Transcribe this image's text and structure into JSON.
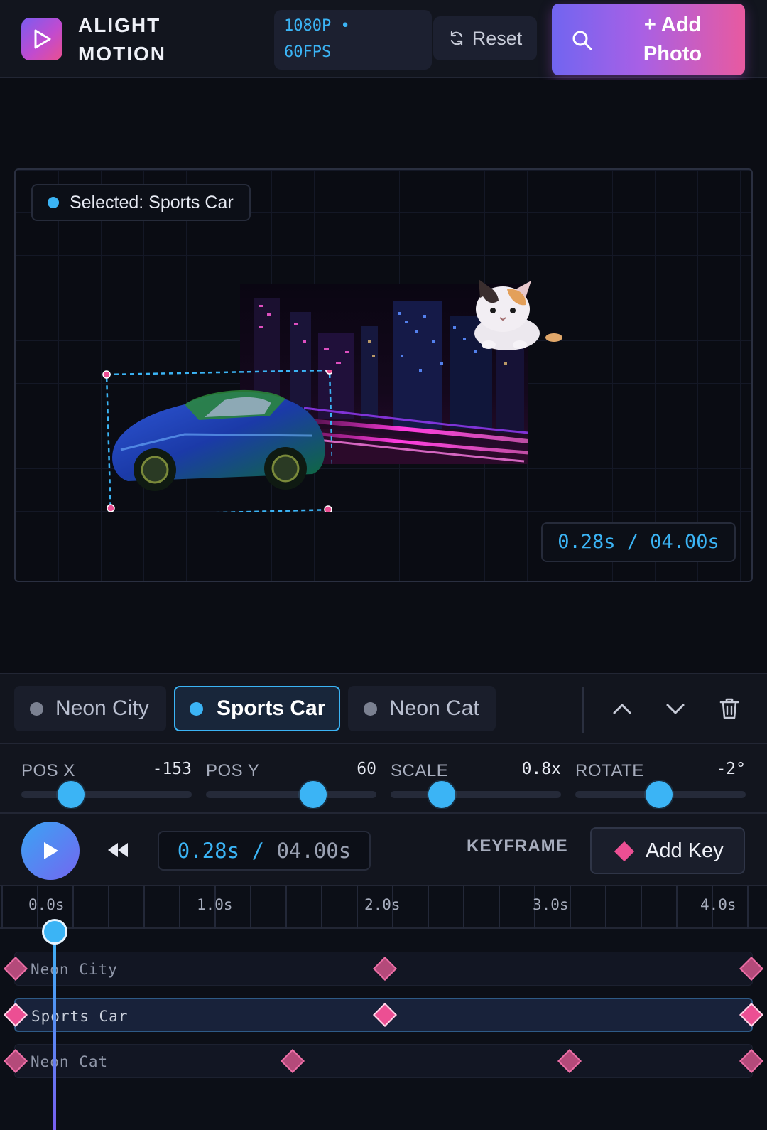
{
  "header": {
    "app_name_line1": "ALIGHT",
    "app_name_line2": "MOTION",
    "resolution_line1": "1080P •",
    "resolution_line2": "60FPS",
    "reset_label": "Reset",
    "add_photo_line1": "+ Add",
    "add_photo_line2": "Photo"
  },
  "canvas": {
    "selected_label": "Selected: Sports Car",
    "time_readout": "0.28s / 04.00s"
  },
  "layers": {
    "tabs": [
      {
        "label": "Neon City",
        "active": false
      },
      {
        "label": "Sports Car",
        "active": true
      },
      {
        "label": "Neon Cat",
        "active": false
      }
    ]
  },
  "properties": [
    {
      "label": "POS X",
      "value": "-153",
      "level": 0.29
    },
    {
      "label": "POS Y",
      "value": "60",
      "level": 0.63
    },
    {
      "label": "SCALE",
      "value": "0.8x",
      "level": 0.3
    },
    {
      "label": "ROTATE",
      "value": "-2°",
      "level": 0.49
    }
  ],
  "transport": {
    "time_current": "0.28s",
    "time_separator": " / ",
    "time_total": "04.00s",
    "keyframe_label": "KEYFRAME",
    "add_key_label": "Add Key"
  },
  "timeline": {
    "ruler_labels": [
      "0.0s",
      "1.0s",
      "2.0s",
      "3.0s",
      "4.0s"
    ],
    "playhead_time": 0.28,
    "tracks": [
      {
        "name": "Neon City",
        "keyframes": [
          0.0,
          2.2,
          4.4
        ],
        "active": false
      },
      {
        "name": "Sports Car",
        "keyframes": [
          0.0,
          2.2,
          4.4
        ],
        "active": true
      },
      {
        "name": "Neon Cat",
        "keyframes": [
          0.0,
          1.65,
          3.3,
          4.4
        ],
        "active": false
      }
    ]
  },
  "colors": {
    "accent": "#3bb4f5",
    "keyframe": "#ec4f93",
    "brand_gradient_start": "#7165f0",
    "brand_gradient_end": "#e85aa0"
  },
  "icons": {
    "logo": "play-triangle-icon",
    "reset": "refresh-icon",
    "add_photo": "search-icon",
    "move_up": "chevron-up-icon",
    "move_down": "chevron-down-icon",
    "delete": "trash-icon",
    "play": "play-icon",
    "rewind": "rewind-icon"
  }
}
